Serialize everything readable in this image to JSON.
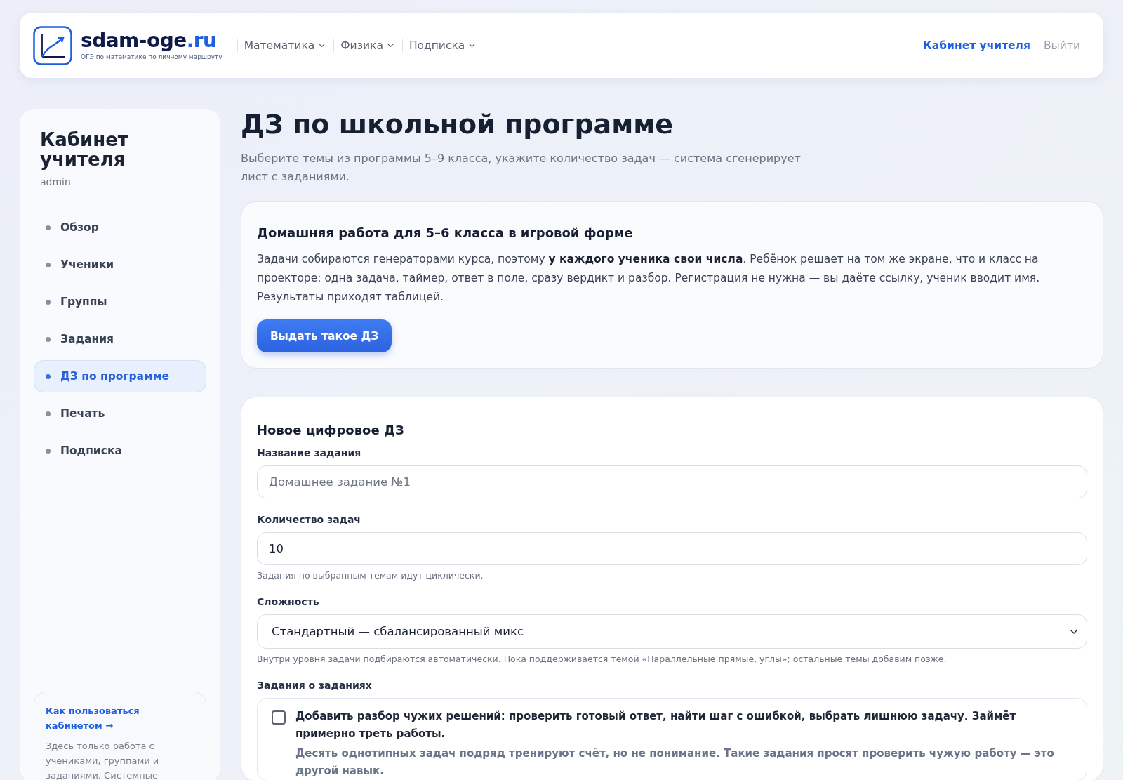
{
  "header": {
    "logo": {
      "name": "sdam-oge",
      "domain": ".ru",
      "tagline": "ОГЭ по математике по личному маршруту"
    },
    "nav": [
      {
        "label": "Математика"
      },
      {
        "label": "Физика"
      },
      {
        "label": "Подписка"
      }
    ],
    "user_links": [
      {
        "label": "Кабинет учителя",
        "kind": "primary"
      },
      {
        "label": "Выйти",
        "kind": "muted"
      }
    ]
  },
  "sidebar": {
    "title": "Кабинет учителя",
    "user": "admin",
    "items": [
      {
        "label": "Обзор",
        "selected": false
      },
      {
        "label": "Ученики",
        "selected": false
      },
      {
        "label": "Группы",
        "selected": false
      },
      {
        "label": "Задания",
        "selected": false
      },
      {
        "label": "ДЗ по программе",
        "selected": true
      },
      {
        "label": "Печать",
        "selected": false
      },
      {
        "label": "Подписка",
        "selected": false
      }
    ],
    "help": {
      "link": "Как пользоваться кабинетом →",
      "text": "Здесь только работа с учениками, группами и заданиями. Системные"
    }
  },
  "page": {
    "title": "ДЗ по школьной программе",
    "subtitle": "Выберите темы из программы 5–9 класса, укажите количество задач — система сгенерирует лист с заданиями."
  },
  "promo": {
    "title": "Домашняя работа для 5–6 класса в игровой форме",
    "text": "Задачи собираются генераторами курса, поэтому **у каждого ученика свои числа**. Ребёнок решает на том же экране, что и класс на проекторе: одна задача, таймер, ответ в поле, сразу вердикт и разбор. Регистрация не нужна — вы даёте ссылку, ученик вводит имя. Результаты приходят таблицей.",
    "button": "Выдать такое ДЗ"
  },
  "form": {
    "title": "Новое цифровое ДЗ",
    "fields": [
      {
        "kind": "text",
        "label": "Название задания",
        "placeholder": "Домашнее задание №1"
      },
      {
        "kind": "text",
        "label": "Количество задач",
        "value": "10",
        "hint": "Задания по выбранным темам идут циклически."
      },
      {
        "kind": "select",
        "label": "Сложность",
        "value": "Стандартный — сбалансированный микс",
        "hint": "Внутри уровня задачи подбираются автоматически. Пока поддерживается темой «Параллельные прямые, углы»; остальные темы добавим позже."
      }
    ],
    "section_label": "Задания о заданиях",
    "option": {
      "checked": false,
      "label": "Добавить разбор чужих решений: проверить готовый ответ, найти шаг с ошибкой, выбрать лишнюю задачу. Займёт примерно треть работы.",
      "description": "Десять однотипных задач подряд тренируют счёт, но не понимание. Такие задания просят проверить чужую работу — это другой навык."
    }
  }
}
